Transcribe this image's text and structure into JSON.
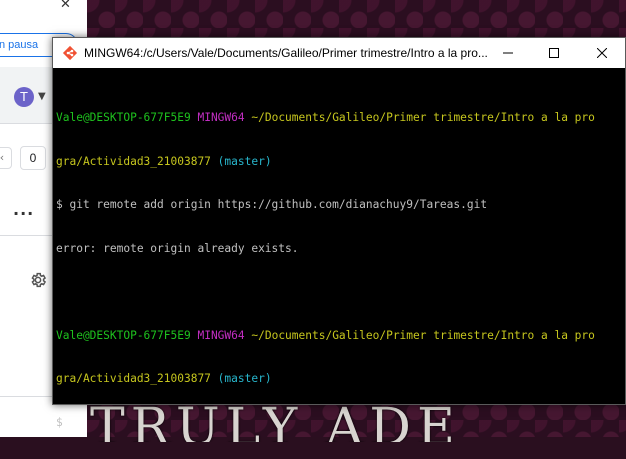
{
  "browser": {
    "pause_label": "n pausa",
    "avatar_letter": "T",
    "counter_value": "0",
    "more_label": "...",
    "close_glyph": "✕"
  },
  "wallpaper": {
    "title_text": "TRULY ADE"
  },
  "terminal": {
    "title": "MINGW64:/c/Users/Vale/Documents/Galileo/Primer trimestre/Intro a la pro...",
    "colors": {
      "background": "#000000",
      "user": "#1ec21e",
      "system": "#c22ec2",
      "path": "#c6c61e",
      "branch": "#28b6cc",
      "text": "#c0c0c0"
    },
    "prompt1": {
      "user_host": "Vale@DESKTOP-677F5E9",
      "system": "MINGW64",
      "path_line1": "~/Documents/Galileo/Primer trimestre/Intro a la pro",
      "path_line2": "gra/Actividad3_21003877",
      "branch": "(master)"
    },
    "command": "$ git remote add origin https://github.com/dianachuy9/Tareas.git",
    "output": "error: remote origin already exists.",
    "prompt2": {
      "user_host": "Vale@DESKTOP-677F5E9",
      "system": "MINGW64",
      "path_line1": "~/Documents/Galileo/Primer trimestre/Intro a la pro",
      "path_line2": "gra/Actividad3_21003877",
      "branch": "(master)"
    },
    "cursor_prompt": "$"
  }
}
